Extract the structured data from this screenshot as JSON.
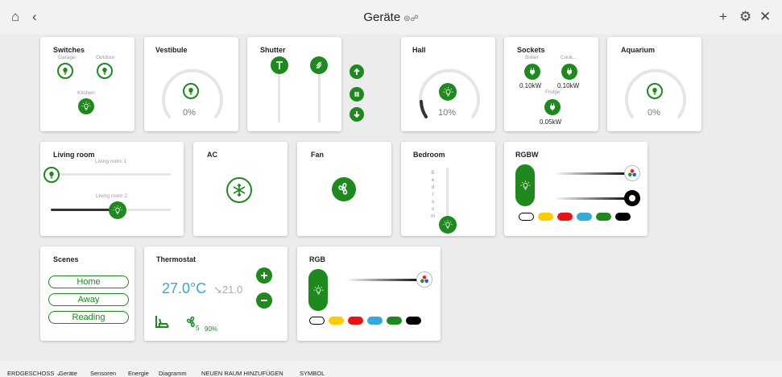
{
  "header": {
    "title": "Geräte",
    "title_suffix": "⊜☍"
  },
  "cards": {
    "switches": {
      "title": "Switches",
      "garage": "Garage",
      "outdoor": "Outdoor",
      "kitchen": "Kitchen"
    },
    "vestibule": {
      "title": "Vestibule",
      "value": "0%"
    },
    "shutter": {
      "title": "Shutter"
    },
    "hall": {
      "title": "Hall",
      "value": "10%"
    },
    "sockets": {
      "title": "Sockets",
      "boiler": "Boiler",
      "boiler_value": "0.10kW",
      "cook": "Cook...",
      "cook_value": "0.10kW",
      "fridge": "Fridge",
      "fridge_value": "0.05kW"
    },
    "aquarium": {
      "title": "Aquarium",
      "value": "0%"
    },
    "living_room": {
      "title": "Living room",
      "label1": "Living room 1",
      "label2": "Living room 2"
    },
    "ac": {
      "title": "AC"
    },
    "fan": {
      "title": "Fan"
    },
    "bedroom": {
      "title": "Bedroom",
      "vertical_label": "Bedroom"
    },
    "rgbw": {
      "title": "RGBW"
    },
    "scenes": {
      "title": "Scenes",
      "items": [
        "Home",
        "Away",
        "Reading"
      ]
    },
    "thermostat": {
      "title": "Thermostat",
      "current": "27.0°C",
      "target": "↘21.0",
      "fan_level": "5",
      "humidity": "90%"
    },
    "rgb": {
      "title": "RGB"
    }
  },
  "swatch_colors": [
    "#ffffff",
    "#ffcc00",
    "#ee1111",
    "#33aadd",
    "#1e8a1e",
    "#000000"
  ],
  "colors": {
    "accent": "#1e8a1e",
    "temperature": "#3aa6d8"
  },
  "footer": {
    "items": [
      "ERDGESCHOSS ⌄",
      "Geräte",
      "Sensoren",
      "Energie",
      "Diagramm",
      "NEUEN RAUM HINZUFÜGEN",
      "SYMBOL"
    ]
  }
}
